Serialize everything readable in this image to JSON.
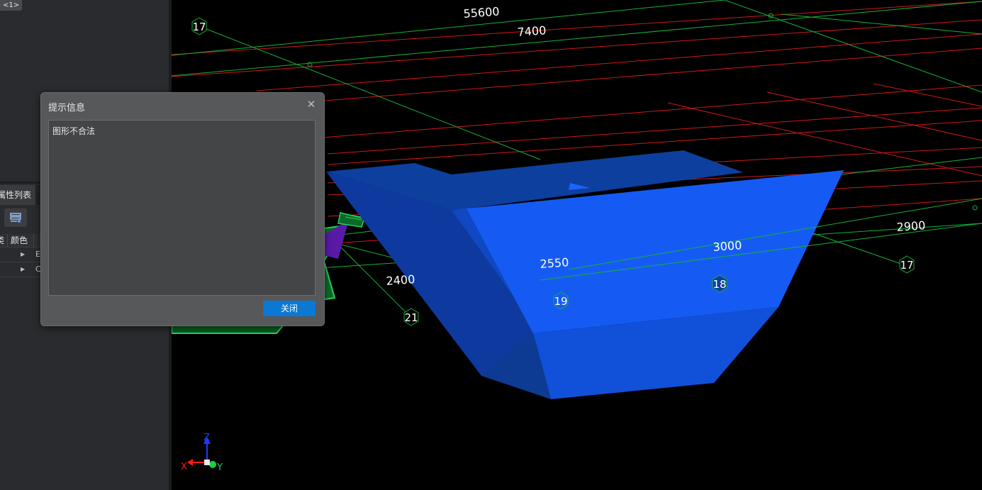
{
  "left_panel": {
    "top_tab": "<1>",
    "properties": {
      "tab_label": "属性列表",
      "columns": [
        "类",
        "颜色"
      ],
      "rows": [
        {
          "value": "E"
        },
        {
          "value": "C"
        }
      ]
    }
  },
  "viewport": {
    "dimensions": [
      {
        "label": "55600"
      },
      {
        "label": "7400"
      },
      {
        "label": "2900"
      },
      {
        "label": "3000"
      },
      {
        "label": "2550"
      },
      {
        "label": "2400"
      }
    ],
    "axis_markers": [
      {
        "label": "17"
      },
      {
        "label": "17"
      },
      {
        "label": "18"
      },
      {
        "label": "19"
      },
      {
        "label": "21"
      }
    ],
    "triad": {
      "x_label": "X",
      "y_label": "Y",
      "z_label": "Z"
    }
  },
  "dialog": {
    "title": "提示信息",
    "message": "图形不合法",
    "close_button_label": "关闭",
    "close_icon": "✕"
  },
  "colors": {
    "beam_fill": "#155bf3",
    "beam_dark": "#0d3f9e",
    "grid_red": "#d01818",
    "grid_green": "#16b036",
    "button_blue": "#0a78d4"
  }
}
